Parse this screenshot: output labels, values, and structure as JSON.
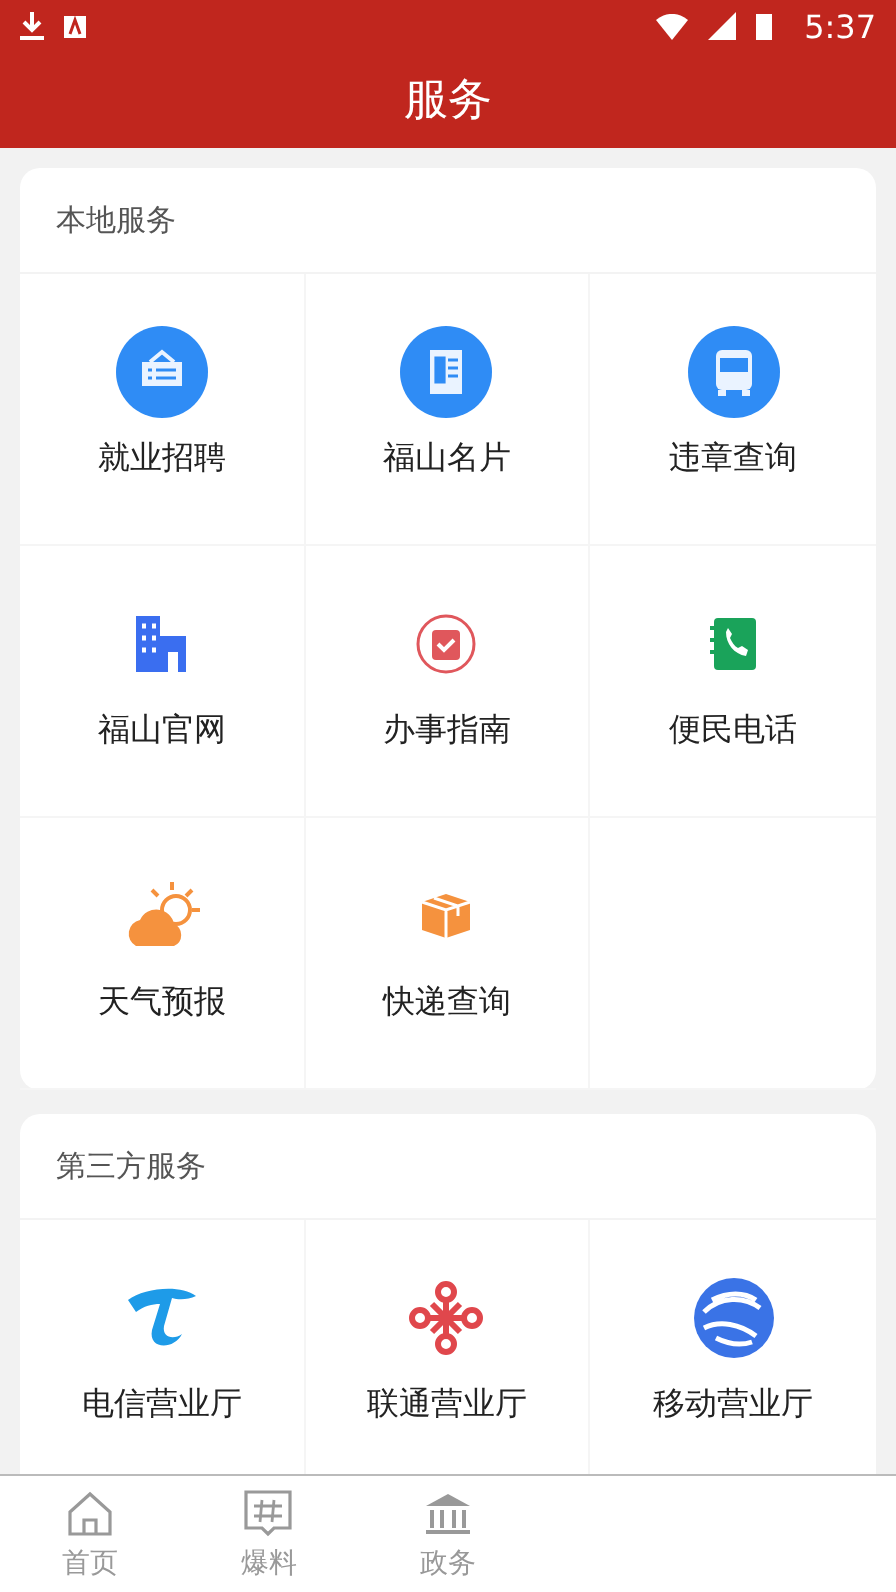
{
  "status_bar": {
    "time": "5:37"
  },
  "header": {
    "title": "服务"
  },
  "sections": [
    {
      "title": "本地服务",
      "items": [
        {
          "label": "就业招聘"
        },
        {
          "label": "福山名片"
        },
        {
          "label": "违章查询"
        },
        {
          "label": "福山官网"
        },
        {
          "label": "办事指南"
        },
        {
          "label": "便民电话"
        },
        {
          "label": "天气预报"
        },
        {
          "label": "快递查询"
        }
      ]
    },
    {
      "title": "第三方服务",
      "items": [
        {
          "label": "电信营业厅"
        },
        {
          "label": "联通营业厅"
        },
        {
          "label": "移动营业厅"
        }
      ]
    }
  ],
  "bottom_nav": [
    {
      "label": "首页",
      "selected": false
    },
    {
      "label": "爆料",
      "selected": false
    },
    {
      "label": "政务",
      "selected": false
    }
  ]
}
